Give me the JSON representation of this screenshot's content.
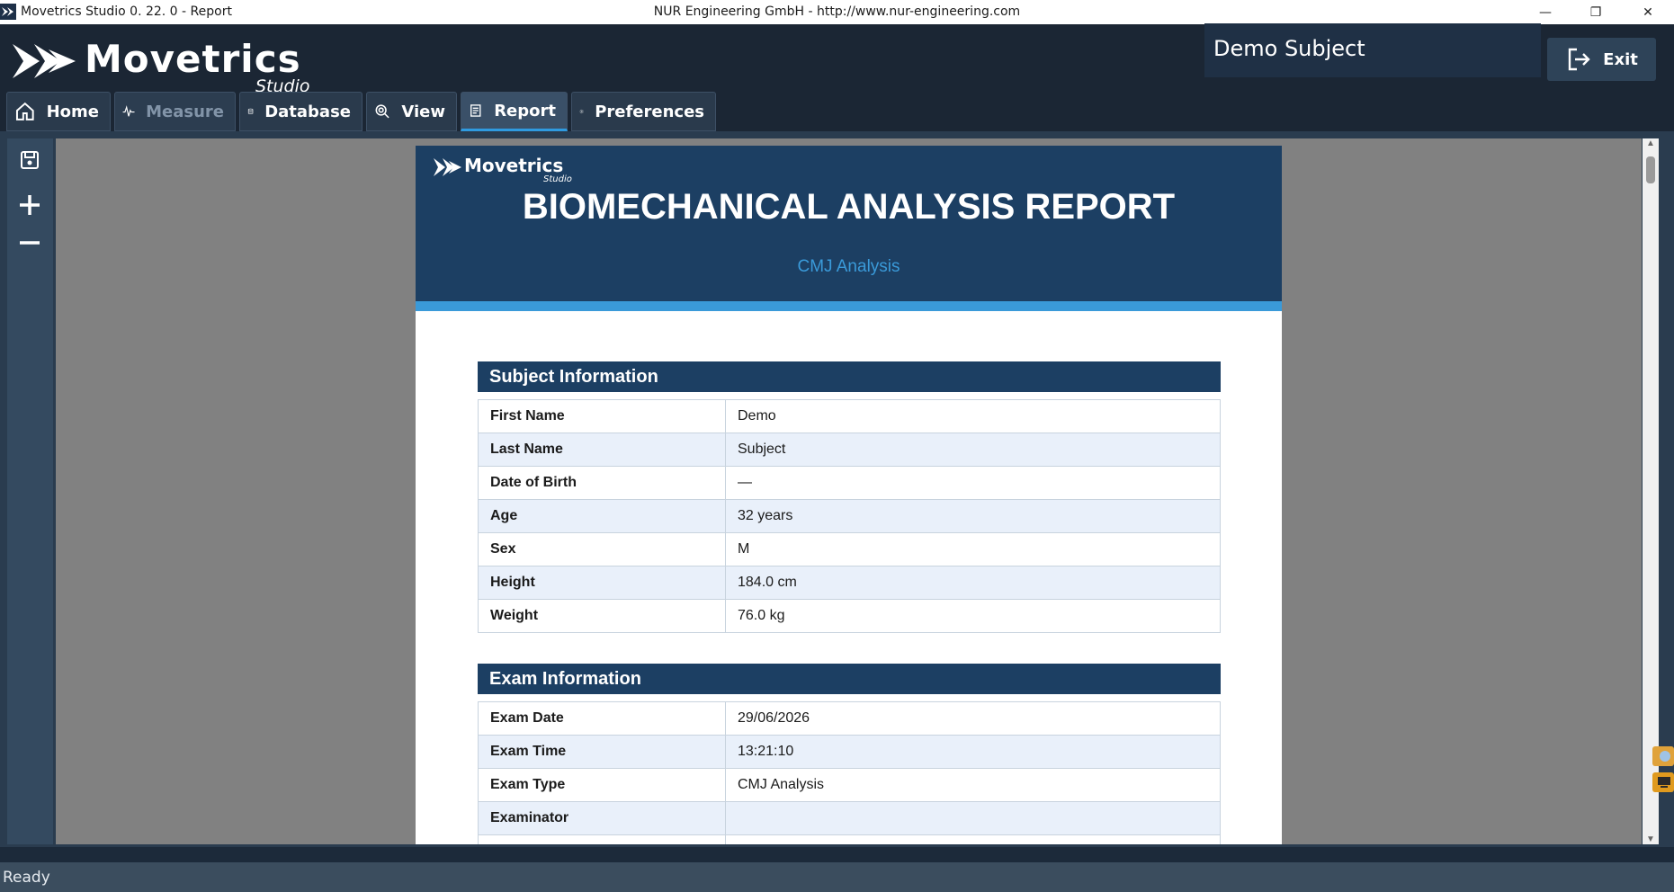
{
  "window": {
    "title": "Movetrics Studio  0. 22. 0 - Report",
    "center_title": "NUR Engineering GmbH - http://www.nur-engineering.com"
  },
  "header": {
    "logo_word": "Movetrics",
    "logo_sub": "Studio",
    "subject": "Demo Subject",
    "exit_label": "Exit"
  },
  "tabs": [
    {
      "label": "Home",
      "icon": "home-icon"
    },
    {
      "label": "Measure",
      "icon": "pulse-icon"
    },
    {
      "label": "Database",
      "icon": "database-icon"
    },
    {
      "label": "View",
      "icon": "eye-icon"
    },
    {
      "label": "Report",
      "icon": "report-icon"
    },
    {
      "label": "Preferences",
      "icon": "gear-icon"
    }
  ],
  "report": {
    "logo_word": "Movetrics",
    "logo_sub": "Studio",
    "title": "BIOMECHANICAL ANALYSIS REPORT",
    "subtitle": "CMJ Analysis",
    "subject_section": {
      "heading": "Subject Information",
      "rows": [
        {
          "key": "First Name",
          "value": "Demo"
        },
        {
          "key": "Last Name",
          "value": "Subject"
        },
        {
          "key": "Date of Birth",
          "value": "—"
        },
        {
          "key": "Age",
          "value": "32 years"
        },
        {
          "key": "Sex",
          "value": "M"
        },
        {
          "key": "Height",
          "value": "184.0 cm"
        },
        {
          "key": "Weight",
          "value": "76.0 kg"
        }
      ]
    },
    "exam_section": {
      "heading": "Exam Information",
      "rows": [
        {
          "key": "Exam Date",
          "value": "29/06/2026"
        },
        {
          "key": "Exam Time",
          "value": "13:21:10"
        },
        {
          "key": "Exam Type",
          "value": "CMJ Analysis"
        },
        {
          "key": "Examinator",
          "value": ""
        }
      ]
    }
  },
  "status": {
    "text": "Ready"
  },
  "colors": {
    "header_bg": "#1b2634",
    "banner": "#1c3f63",
    "accent": "#3a9ad9",
    "row_alt": "#e9f0fa"
  }
}
